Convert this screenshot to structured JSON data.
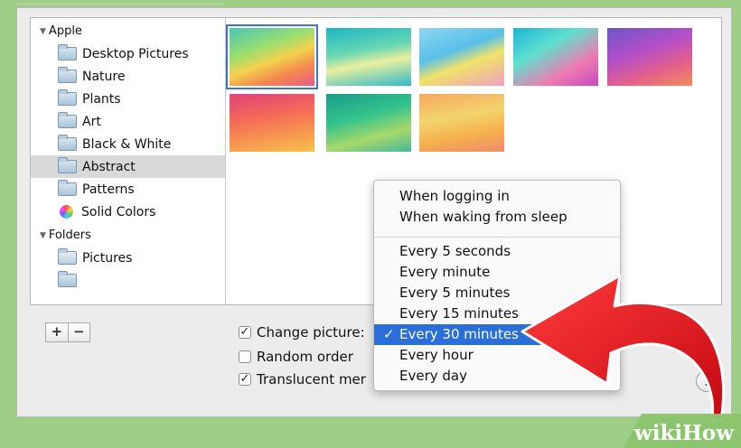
{
  "sidebar": {
    "groups": [
      {
        "label": "Apple"
      },
      {
        "label": "Folders"
      }
    ],
    "items": [
      {
        "label": "Desktop Pictures"
      },
      {
        "label": "Nature"
      },
      {
        "label": "Plants"
      },
      {
        "label": "Art"
      },
      {
        "label": "Black & White"
      },
      {
        "label": "Abstract"
      },
      {
        "label": "Patterns"
      },
      {
        "label": "Solid Colors"
      },
      {
        "label": "Pictures"
      },
      {
        "label": ""
      }
    ],
    "selected": "Abstract"
  },
  "buttons": {
    "add": "+",
    "remove": "−",
    "help": "?"
  },
  "options": {
    "change_picture": {
      "label": "Change picture:",
      "checked": true
    },
    "random_order": {
      "label": "Random order",
      "checked": false
    },
    "translucent_menu": {
      "label": "Translucent mer",
      "checked": true
    }
  },
  "interval_menu": {
    "items": [
      "When logging in",
      "When waking from sleep",
      "Every 5 seconds",
      "Every minute",
      "Every 5 minutes",
      "Every 15 minutes",
      "Every 30 minutes",
      "Every hour",
      "Every day"
    ],
    "selected": "Every 30 minutes",
    "check_mark": "✓"
  },
  "watermark": {
    "wiki": "wiki",
    "how": "How"
  },
  "colors": {
    "selection_blue": "#2a6ed9",
    "arrow_red": "#e0121b",
    "background_green": "#9fcf86"
  }
}
